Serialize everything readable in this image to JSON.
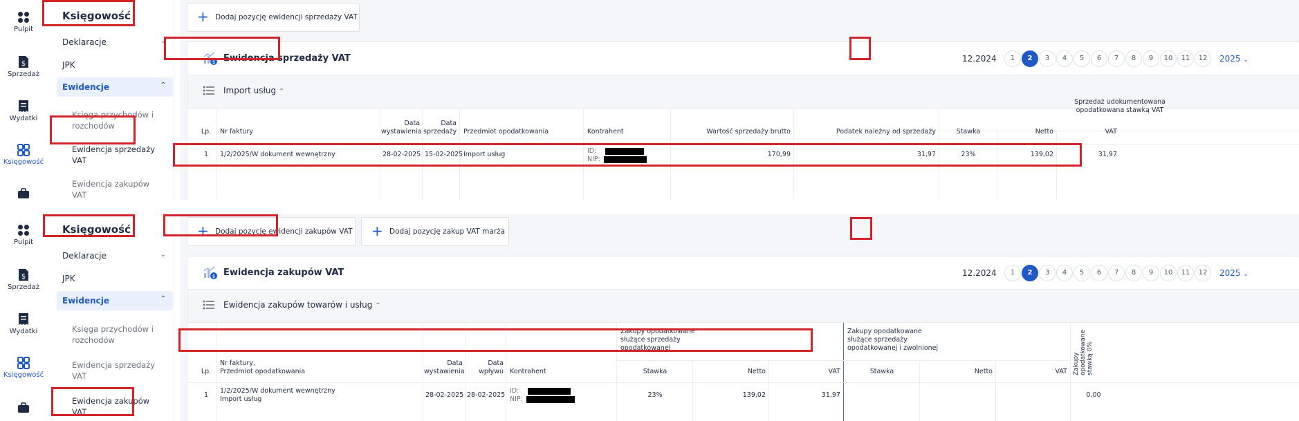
{
  "colors": {
    "accent": "#1f59c6",
    "highlight": "#d3222a",
    "active_bg": "#eaf1fd"
  },
  "icon_rail": [
    {
      "label": "Pulpit",
      "icon": "grid-icon"
    },
    {
      "label": "Sprzedaż",
      "icon": "invoice-dollar-icon"
    },
    {
      "label": "Wydatki",
      "icon": "receipt-icon"
    },
    {
      "label": "Księgowość",
      "icon": "apps-icon",
      "active": true
    },
    {
      "label": "",
      "icon": "briefcase-icon"
    }
  ],
  "sidebar": {
    "title": "Księgowość",
    "items": {
      "deklaracje": "Deklaracje",
      "jpk": "JPK",
      "ewidencje": "Ewidencje"
    },
    "sub": {
      "ksiega_1": "Księga przychodów i",
      "ksiega_2": "rozchodów",
      "sprzedaz_1": "Ewidencja sprzedaży",
      "sprzedaz_2": "VAT",
      "zakupy_1": "Ewidencja zakupów",
      "zakupy_2": "VAT"
    }
  },
  "months": [
    "1",
    "2",
    "3",
    "4",
    "5",
    "6",
    "7",
    "8",
    "9",
    "10",
    "11",
    "12"
  ],
  "selected_month": "2",
  "sales": {
    "add_button": "Dodaj pozycję ewidencji sprzedaży VAT",
    "title": "Ewidencja sprzedaży VAT",
    "period": "12.2024",
    "year": "2025",
    "section": "Import usług",
    "headers": {
      "lp": "Lp.",
      "nr": "Nr faktury",
      "data_wyst_1": "Data",
      "data_wyst_2": "wystawienia",
      "data_sprz_1": "Data",
      "data_sprz_2": "sprzedaży",
      "przedmiot": "Przedmiot opodatkowania",
      "kontrahent": "Kontrahent",
      "brutto": "Wartość sprzedaży brutto",
      "podatek": "Podatek należny od sprzedaży",
      "group_1": "Sprzedaż udokumentowana",
      "group_2": "opodatkowana stawką VAT",
      "stawka": "Stawka",
      "netto": "Netto",
      "vat": "VAT"
    },
    "row": {
      "lp": "1",
      "nr": "1/2/2025/W dokument wewnętrzny",
      "data_wyst": "28-02-2025",
      "data_sprz": "15-02-2025",
      "przedmiot": "Import usług",
      "id_label": "ID:",
      "nip_label": "NIP:",
      "brutto": "170,99",
      "podatek": "31,97",
      "stawka": "23%",
      "netto": "139,02",
      "vat": "31,97"
    }
  },
  "purchases": {
    "add_button_1": "Dodaj pozycję ewidencji zakupów VAT",
    "add_button_2": "Dodaj pozycję zakup VAT marża",
    "title": "Ewidencja zakupów VAT",
    "period": "12.2024",
    "year": "2025",
    "section": "Ewidencja zakupów towarów i usług",
    "headers": {
      "lp": "Lp.",
      "nr_1": "Nr faktury,",
      "nr_2": "Przedmiot opodatkowania",
      "data_wyst_1": "Data",
      "data_wyst_2": "wystawienia",
      "data_wpl_1": "Data",
      "data_wpl_2": "wpływu",
      "kontrahent": "Kontrahent",
      "group_a_1": "Zakupy opodatkowane",
      "group_a_2": "służące sprzedaży",
      "group_a_3": "opodatkowanej",
      "group_b_1": "Zakupy opodatkowane",
      "group_b_2": "służące sprzedaży",
      "group_b_3": "opodatkowanej i zwolnionej",
      "group_c": "Zakupy opodatkowane stawką 0%",
      "stawka": "Stawka",
      "netto": "Netto",
      "vat": "VAT"
    },
    "row": {
      "lp": "1",
      "nr": "1/2/2025/W dokument wewnętrzny",
      "przedmiot": "Import usług",
      "data_wyst": "28-02-2025",
      "data_wpl": "28-02-2025",
      "id_label": "ID:",
      "nip_label": "NIP:",
      "stawka": "23%",
      "netto": "139,02",
      "vat": "31,97",
      "zero": "0,00"
    }
  }
}
